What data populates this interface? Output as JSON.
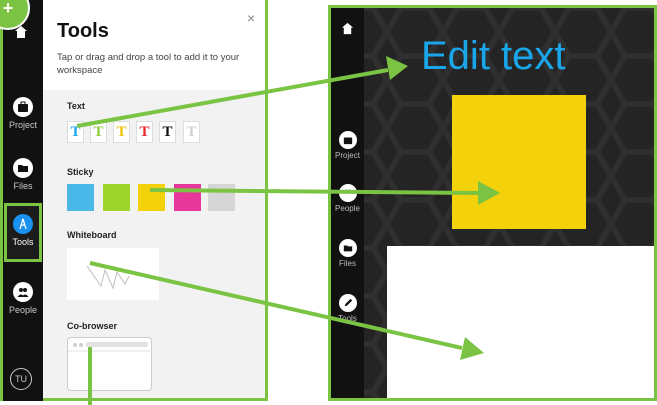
{
  "badge": {
    "text": "+"
  },
  "left_rail": {
    "items": [
      {
        "name": "project",
        "label": "Project"
      },
      {
        "name": "files",
        "label": "Files"
      },
      {
        "name": "tools",
        "label": "Tools"
      },
      {
        "name": "people",
        "label": "People"
      }
    ],
    "avatar": "TU"
  },
  "tools_panel": {
    "title": "Tools",
    "subtitle": "Tap or drag and drop a tool to add it to your workspace",
    "close": "×",
    "sections": {
      "text": "Text",
      "sticky": "Sticky",
      "whiteboard": "Whiteboard",
      "cobrowser": "Co-browser"
    },
    "text_tools": [
      {
        "glyph": "T",
        "color": "#1aa7ea"
      },
      {
        "glyph": "T",
        "color": "#95c93d"
      },
      {
        "glyph": "T",
        "color": "#f2c500"
      },
      {
        "glyph": "T",
        "color": "#e8262e"
      },
      {
        "glyph": "T",
        "color": "#111111"
      },
      {
        "glyph": "T",
        "color": "#d0d0d0"
      }
    ],
    "sticky_colors": [
      "#4bb8ea",
      "#9fd42a",
      "#f4d20b",
      "#e8379b",
      "#d6d6d6"
    ]
  },
  "workspace": {
    "rail": [
      {
        "name": "project",
        "label": "Project"
      },
      {
        "name": "people",
        "label": "People"
      },
      {
        "name": "files",
        "label": "Files"
      },
      {
        "name": "tools",
        "label": "Tools"
      }
    ],
    "edit_text": "Edit text",
    "sticky_color": "#f4d20b"
  },
  "colors": {
    "accent": "#7bc443",
    "arrow": "#7bc443",
    "link": "#1aa7ea",
    "active_tool": "#1a90ef"
  }
}
